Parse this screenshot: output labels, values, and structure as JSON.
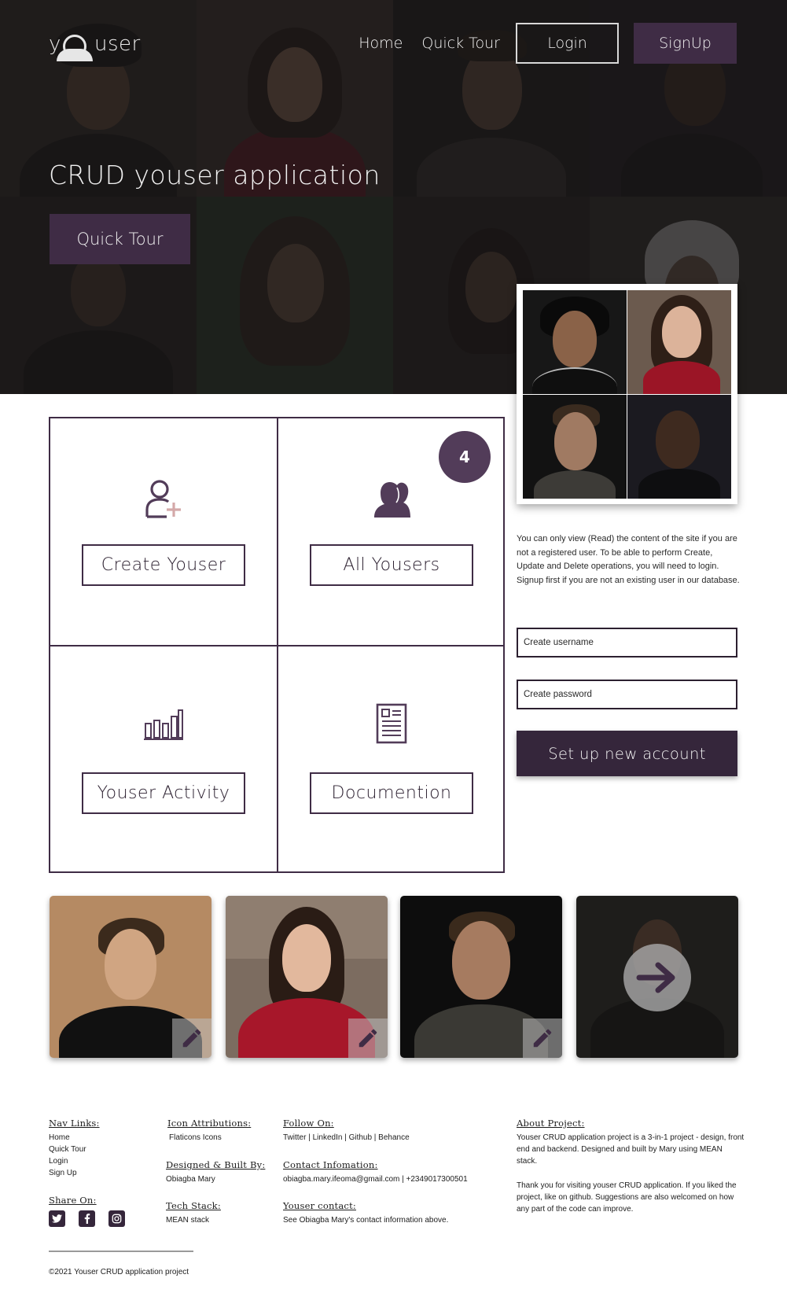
{
  "brand": {
    "logo_prefix": "y",
    "logo_suffix": "user"
  },
  "nav": {
    "home": "Home",
    "quick_tour": "Quick Tour",
    "login": "Login",
    "signup": "SignUp"
  },
  "hero": {
    "title": "CRUD youser application",
    "button": "Quick Tour"
  },
  "cards": {
    "create": "Create Youser",
    "all": "All Yousers",
    "activity": "Youser Activity",
    "docs": "Documention",
    "user_count": "4"
  },
  "sidebar": {
    "info": "You can only view (Read) the content of the site if you are not a registered user. To be able to perform Create, Update and Delete operations, you will need to login. Signup first if you are not an existing user in our database.",
    "username_placeholder": "Create username",
    "password_placeholder": "Create password",
    "submit": "Set up new account"
  },
  "icons": {
    "add_user": "add-user-icon",
    "group": "users-group-icon",
    "chart": "bar-chart-icon",
    "document": "document-icon",
    "edit": "pencil-icon",
    "next": "arrow-right-icon"
  },
  "colors": {
    "accent": "#3f2c45",
    "badge": "#523c59",
    "hero_overlay": "#1f1d1c"
  },
  "footer": {
    "nav_heading": "Nav Links:",
    "nav_links": [
      "Home",
      "Quick Tour",
      "Login",
      "Sign Up"
    ],
    "share_heading": "Share On:",
    "icon_attr_heading": "Icon Attributions:",
    "icon_attr": "Flaticons Icons",
    "designed_heading": "Designed & Built By:",
    "designed": "Obiagba Mary",
    "tech_heading": "Tech Stack:",
    "tech": "MEAN  stack",
    "follow_heading": "Follow On:",
    "follow": "Twitter  |  LinkedIn  |  Github  |  Behance",
    "contact_heading": "Contact Infomation:",
    "contact": "obiagba.mary.ifeoma@gmail.com  |  +2349017300501",
    "youser_contact_heading": "Youser contact:",
    "youser_contact": "See Obiagba Mary's contact information above.",
    "about_heading": "About Project:",
    "about_1": "Youser CRUD application project is  a 3-in-1 project - design, front end and backend. Designed and built by Mary using MEAN stack.",
    "about_2": "Thank you for  visiting youser CRUD application. If you liked the project, like on github. Suggestions are also welcomed on how any part of the code can improve.",
    "copyright": "©2021 Youser CRUD application project"
  }
}
